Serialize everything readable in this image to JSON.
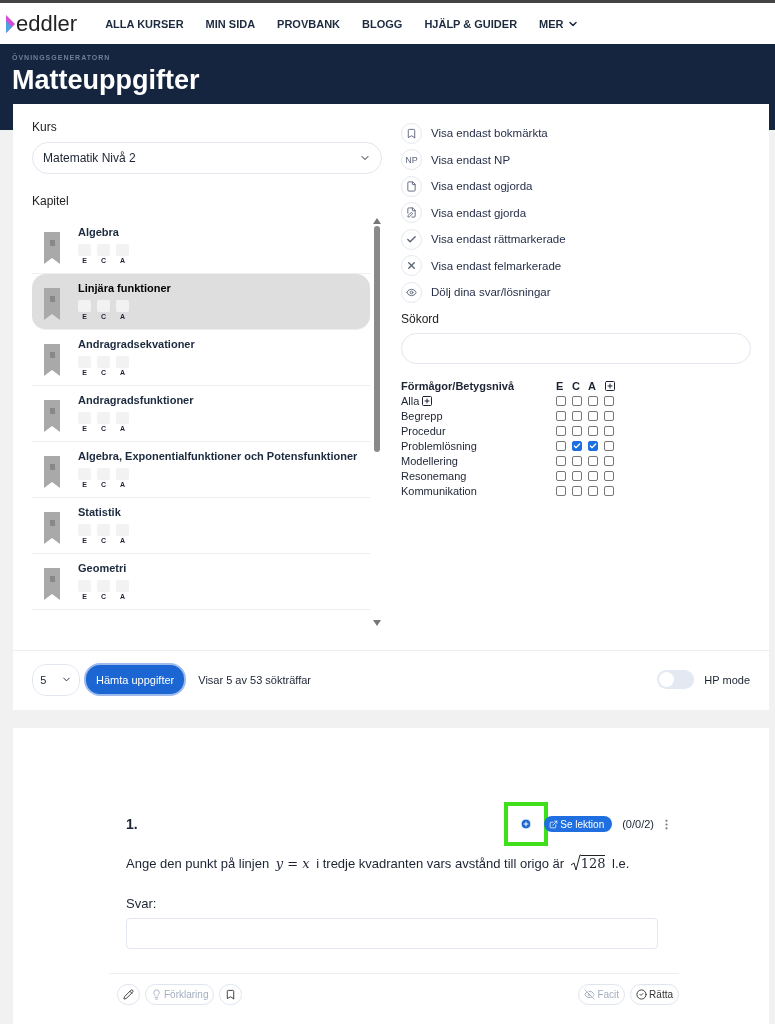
{
  "nav": {
    "logo": "eddler",
    "links": [
      {
        "label": "ALLA KURSER"
      },
      {
        "label": "MIN SIDA"
      },
      {
        "label": "PROVBANK"
      },
      {
        "label": "BLOGG"
      },
      {
        "label": "HJÄLP & GUIDER"
      },
      {
        "label": "MER",
        "dropdown": true
      }
    ]
  },
  "hero": {
    "eyebrow": "ÖVNINGSGENERATORN",
    "title": "Matteuppgifter"
  },
  "course": {
    "label": "Kurs",
    "value": "Matematik Nivå 2"
  },
  "chapters": {
    "label": "Kapitel",
    "items": [
      {
        "title": "Algebra",
        "selected": false,
        "grades": [
          "E",
          "C",
          "A"
        ]
      },
      {
        "title": "Linjära funktioner",
        "selected": true,
        "grades": [
          "E",
          "C",
          "A"
        ]
      },
      {
        "title": "Andragradsekvationer",
        "selected": false,
        "grades": [
          "E",
          "C",
          "A"
        ]
      },
      {
        "title": "Andragradsfunktioner",
        "selected": false,
        "grades": [
          "E",
          "C",
          "A"
        ]
      },
      {
        "title": "Algebra, Exponentialfunktioner och Potensfunktioner",
        "selected": false,
        "grades": [
          "E",
          "C",
          "A"
        ]
      },
      {
        "title": "Statistik",
        "selected": false,
        "grades": [
          "E",
          "C",
          "A"
        ]
      },
      {
        "title": "Geometri",
        "selected": false,
        "grades": [
          "E",
          "C",
          "A"
        ]
      }
    ]
  },
  "filters": [
    {
      "kind": "bookmark",
      "label": "Visa endast bokmärkta"
    },
    {
      "kind": "badge",
      "badge": "NP",
      "label": "Visa endast NP"
    },
    {
      "kind": "file",
      "label": "Visa endast ogjorda"
    },
    {
      "kind": "edit",
      "label": "Visa endast gjorda"
    },
    {
      "kind": "check",
      "label": "Visa endast rättmarkerade"
    },
    {
      "kind": "cross",
      "label": "Visa endast felmarkerade"
    },
    {
      "kind": "eye",
      "label": "Dölj dina svar/lösningar"
    }
  ],
  "search": {
    "label": "Sökord"
  },
  "abilities": {
    "heading": "Förmågor/Betygsnivå",
    "columns": [
      "E",
      "C",
      "A"
    ],
    "rows": [
      {
        "name": "Alla",
        "expandable": true,
        "checks": [
          false,
          false,
          false,
          false
        ]
      },
      {
        "name": "Begrepp",
        "expandable": false,
        "checks": [
          false,
          false,
          false,
          false
        ]
      },
      {
        "name": "Procedur",
        "expandable": false,
        "checks": [
          false,
          false,
          false,
          false
        ]
      },
      {
        "name": "Problemlösning",
        "expandable": false,
        "checks": [
          false,
          true,
          true,
          false
        ]
      },
      {
        "name": "Modellering",
        "expandable": false,
        "checks": [
          false,
          false,
          false,
          false
        ]
      },
      {
        "name": "Resonemang",
        "expandable": false,
        "checks": [
          false,
          false,
          false,
          false
        ]
      },
      {
        "name": "Kommunikation",
        "expandable": false,
        "checks": [
          false,
          false,
          false,
          false
        ]
      }
    ]
  },
  "toolbar": {
    "count": "5",
    "fetch_button": "Hämta uppgifter",
    "results": "Visar 5 av 53 sökträffar",
    "hp_mode": {
      "label": "HP mode",
      "on": false
    }
  },
  "question": {
    "number": "1.",
    "highlighted": true,
    "lesson_button": "Se lektion",
    "score": "(0/0/2)",
    "parts": [
      {
        "kind": "text",
        "text": "Ange den punkt på linjen "
      },
      {
        "kind": "math",
        "text": "y = x"
      },
      {
        "kind": "text",
        "text": " i tredje kvadranten vars avstånd till origo är "
      },
      {
        "kind": "sqrt",
        "text": "128"
      },
      {
        "kind": "text",
        "text": " l.e."
      }
    ],
    "answer_label": "Svar:",
    "footer": [
      {
        "kind": "edit",
        "disabled": false
      },
      {
        "kind": "explain",
        "label": "Förklaring",
        "disabled": true
      },
      {
        "kind": "bookmark",
        "disabled": false
      },
      {
        "kind": "spacer"
      },
      {
        "kind": "facit",
        "label": "Facit",
        "disabled": true
      },
      {
        "kind": "grade",
        "label": "Rätta",
        "disabled": false
      }
    ]
  }
}
